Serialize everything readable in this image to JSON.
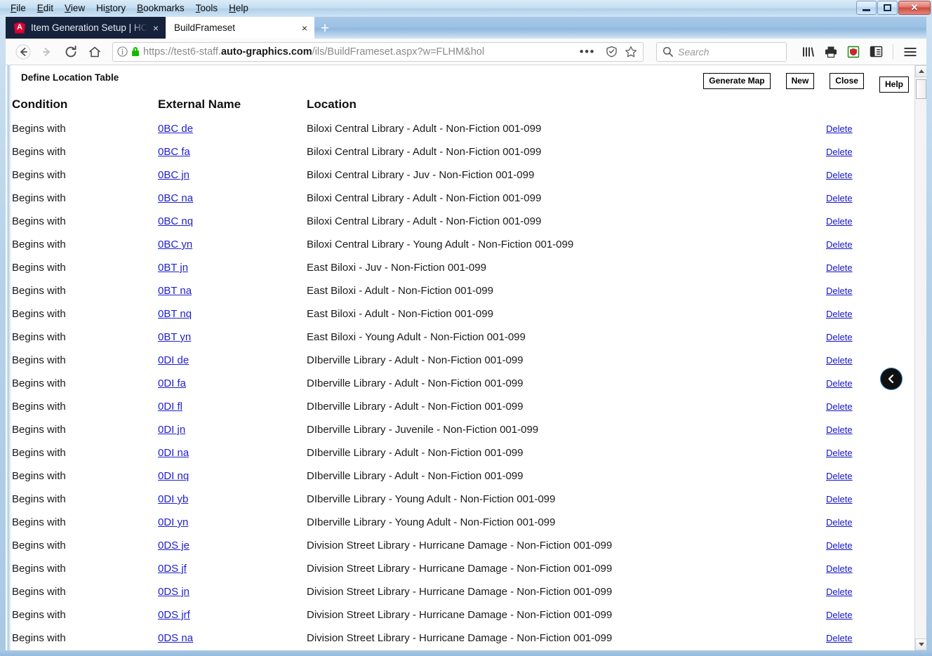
{
  "window": {
    "menus": [
      "File",
      "Edit",
      "View",
      "History",
      "Bookmarks",
      "Tools",
      "Help"
    ],
    "controls": {
      "minimize": "Minimize",
      "maximize": "Restore",
      "close": "Close"
    }
  },
  "tabs": [
    {
      "title": "Item Generation Setup | HCOLS",
      "active": false,
      "favicon": "angular-icon",
      "close_label": "×"
    },
    {
      "title": "BuildFrameset",
      "active": true,
      "favicon": "none",
      "close_label": "×"
    }
  ],
  "newtab_label": "+",
  "navbar": {
    "back_label": "Back",
    "forward_label": "Forward",
    "reload_label": "Reload",
    "home_label": "Home",
    "url": "https://test6-staff.auto-graphics.com/ils/BuildFrameset.aspx?w=FLHM&hol",
    "url_scheme": "https://test6-staff.",
    "url_domain": "auto-graphics.com",
    "url_path": "/ils/BuildFrameset.aspx?w=FLHM&hol",
    "page_actions_label": "•••",
    "reader_label": "Reader View",
    "bookmark_label": "Bookmark this page",
    "search_placeholder": "Search",
    "toolbar_icons": [
      "library-icon",
      "print-icon",
      "ublock-shield-icon",
      "sidebar-toggle-icon",
      "hamburger-menu-icon"
    ]
  },
  "page": {
    "title": "Define Location Table",
    "buttons": {
      "generate_map": "Generate Map",
      "new": "New",
      "close": "Close",
      "help": "Help"
    },
    "columns": [
      "Condition",
      "External Name",
      "Location"
    ],
    "delete_label": "Delete",
    "collapse_handle_label": "Collapse panel",
    "rows": [
      {
        "condition": "Begins with",
        "external_name": "0BC de",
        "location": "Biloxi Central Library - Adult - Non-Fiction 001-099"
      },
      {
        "condition": "Begins with",
        "external_name": "0BC fa",
        "location": "Biloxi Central Library - Adult - Non-Fiction 001-099"
      },
      {
        "condition": "Begins with",
        "external_name": "0BC jn",
        "location": "Biloxi Central Library - Juv - Non-Fiction 001-099"
      },
      {
        "condition": "Begins with",
        "external_name": "0BC na",
        "location": "Biloxi Central Library - Adult - Non-Fiction 001-099"
      },
      {
        "condition": "Begins with",
        "external_name": "0BC nq",
        "location": "Biloxi Central Library - Adult - Non-Fiction 001-099"
      },
      {
        "condition": "Begins with",
        "external_name": "0BC yn",
        "location": "Biloxi Central Library - Young Adult - Non-Fiction 001-099"
      },
      {
        "condition": "Begins with",
        "external_name": "0BT jn",
        "location": "East Biloxi - Juv - Non-Fiction 001-099"
      },
      {
        "condition": "Begins with",
        "external_name": "0BT na",
        "location": "East Biloxi - Adult - Non-Fiction 001-099"
      },
      {
        "condition": "Begins with",
        "external_name": "0BT nq",
        "location": "East Biloxi - Adult - Non-Fiction 001-099"
      },
      {
        "condition": "Begins with",
        "external_name": "0BT yn",
        "location": "East Biloxi - Young Adult - Non-Fiction 001-099"
      },
      {
        "condition": "Begins with",
        "external_name": "0DI de",
        "location": "DIberville Library - Adult - Non-Fiction 001-099"
      },
      {
        "condition": "Begins with",
        "external_name": "0DI fa",
        "location": "DIberville Library - Adult - Non-Fiction 001-099"
      },
      {
        "condition": "Begins with",
        "external_name": "0DI fl",
        "location": "DIberville Library - Adult - Non-Fiction 001-099"
      },
      {
        "condition": "Begins with",
        "external_name": "0DI jn",
        "location": "DIberville Library - Juvenile - Non-Fiction 001-099"
      },
      {
        "condition": "Begins with",
        "external_name": "0DI na",
        "location": "DIberville Library - Adult - Non-Fiction 001-099"
      },
      {
        "condition": "Begins with",
        "external_name": "0DI nq",
        "location": "DIberville Library - Adult - Non-Fiction 001-099"
      },
      {
        "condition": "Begins with",
        "external_name": "0DI yb",
        "location": "DIberville Library - Young Adult - Non-Fiction 001-099"
      },
      {
        "condition": "Begins with",
        "external_name": "0DI yn",
        "location": "DIberville Library - Young Adult - Non-Fiction 001-099"
      },
      {
        "condition": "Begins with",
        "external_name": "0DS je",
        "location": "Division Street Library - Hurricane Damage - Non-Fiction 001-099"
      },
      {
        "condition": "Begins with",
        "external_name": "0DS jf",
        "location": "Division Street Library - Hurricane Damage - Non-Fiction 001-099"
      },
      {
        "condition": "Begins with",
        "external_name": "0DS jn",
        "location": "Division Street Library - Hurricane Damage - Non-Fiction 001-099"
      },
      {
        "condition": "Begins with",
        "external_name": "0DS jrf",
        "location": "Division Street Library - Hurricane Damage - Non-Fiction 001-099"
      },
      {
        "condition": "Begins with",
        "external_name": "0DS na",
        "location": "Division Street Library - Hurricane Damage - Non-Fiction 001-099"
      }
    ]
  },
  "colors": {
    "link": "#2222cc",
    "delete_link": "#1414c8",
    "tab_inactive_bg": "#16213b",
    "close_button": "#cc4a3e",
    "lock_green": "#12bc00"
  }
}
